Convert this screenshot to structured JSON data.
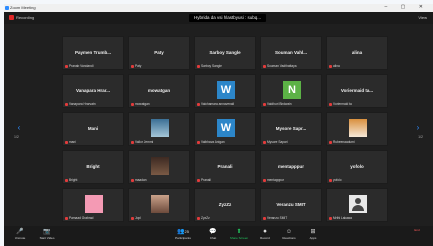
{
  "window": {
    "app_title": "Zoom Meeting",
    "controls": "– ▢ ✕"
  },
  "topbar": {
    "recording": "Recording",
    "meeting_title": "Hybrida da vsi hlastbyusi : subq...",
    "view": "View"
  },
  "tiles": [
    {
      "name": "Paymen Trumb...",
      "label": "Pranab Vandandi",
      "avatar": null
    },
    {
      "name": "Paty",
      "label": "Paty",
      "avatar": null
    },
    {
      "name": "Sarboy Sangle",
      "label": "Sarboy Sangle",
      "avatar": null
    },
    {
      "name": "Souman Vahl...",
      "label": "Souman Vadthattaya",
      "avatar": null
    },
    {
      "name": "alina",
      "label": "alina",
      "avatar": null
    },
    {
      "name": "Vanapara Hrar...",
      "label": "Vanapara Hrarvatn",
      "avatar": null
    },
    {
      "name": "mowatgan",
      "label": "mowatgan",
      "avatar": null
    },
    {
      "name": "",
      "label": "Vaichamara annavenali",
      "avatar": "W"
    },
    {
      "name": "",
      "label": "Vaidhuri Birdwain",
      "avatar": "N"
    },
    {
      "name": "Voriermaid ta...",
      "label": "Voriermaid ta",
      "avatar": null
    },
    {
      "name": "Mani",
      "label": "mani",
      "avatar": null
    },
    {
      "name": "",
      "label": "Vallor Jemmi",
      "avatar": "photo1"
    },
    {
      "name": "",
      "label": "Vaibhava Anigan",
      "avatar": "W"
    },
    {
      "name": "Mysore Sapr...",
      "label": "Mysore Sapari",
      "avatar": null
    },
    {
      "name": "",
      "label": "Rubeenaadumi",
      "avatar": "photo2"
    },
    {
      "name": "Bright",
      "label": "Bright",
      "avatar": null
    },
    {
      "name": "",
      "label": "maadan",
      "avatar": "photo3"
    },
    {
      "name": "Pranali",
      "label": "Pranali",
      "avatar": null
    },
    {
      "name": "mentapppur",
      "label": "mentapppur",
      "avatar": null
    },
    {
      "name": "yofolo",
      "label": "yofolo",
      "avatar": null
    },
    {
      "name": "",
      "label": "Pamaad Grabrad",
      "avatar": "pink"
    },
    {
      "name": "",
      "label": "Jopl",
      "avatar": "photo4"
    },
    {
      "name": "ZyzZz",
      "label": "ZyzZz",
      "avatar": null
    },
    {
      "name": "Veranzu SMIT",
      "label": "Veranzu SMIT",
      "avatar": null
    },
    {
      "name": "",
      "label": "Mrthi Lakawa",
      "avatar": "user"
    }
  ],
  "pager": {
    "prev": "‹",
    "next": "›",
    "prev_page": "1/2",
    "next_page": "1/2"
  },
  "toolbar": {
    "unmute": {
      "icon": "🎤",
      "label": "Unmute"
    },
    "start_video": {
      "icon": "📷",
      "label": "Start Video"
    },
    "participants": {
      "icon": "👥",
      "label": "Participants",
      "count": "25"
    },
    "chat": {
      "icon": "💬",
      "label": "Chat"
    },
    "share": {
      "icon": "⬆",
      "label": "Share Screen"
    },
    "record": {
      "icon": "⏺",
      "label": "Record"
    },
    "reactions": {
      "icon": "☺",
      "label": "Reactions"
    },
    "apps": {
      "icon": "⊞",
      "label": "Apps"
    },
    "end": {
      "icon": "",
      "label": "End"
    }
  }
}
